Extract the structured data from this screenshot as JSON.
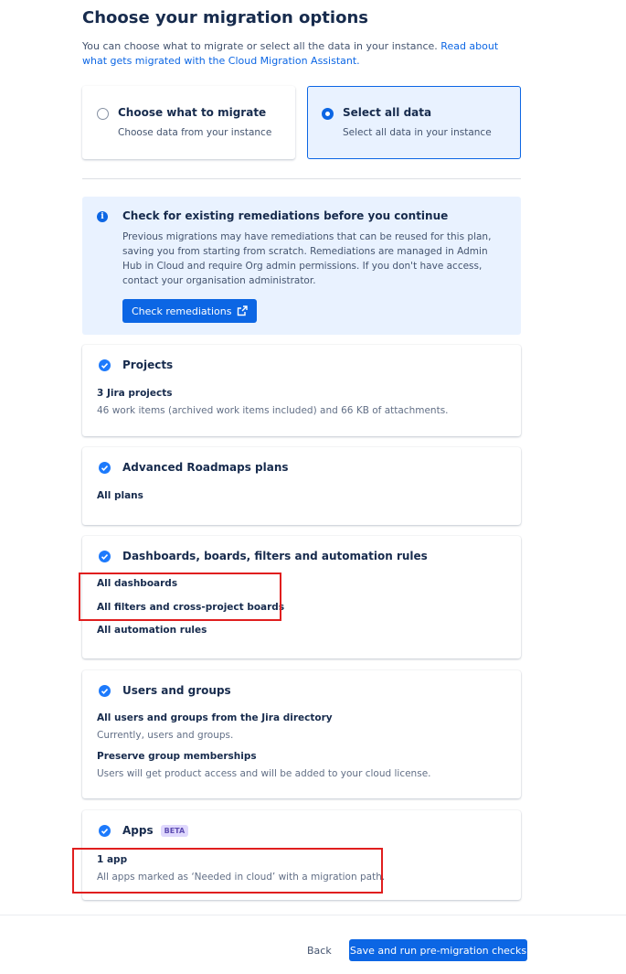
{
  "page": {
    "title": "Choose your migration options",
    "intro_text": "You can choose what to migrate or select all the data in your instance. ",
    "intro_link": "Read about what gets migrated with the Cloud Migration Assistant."
  },
  "options": [
    {
      "title": "Choose what to migrate",
      "desc": "Choose data from your instance",
      "selected": false
    },
    {
      "title": "Select all data",
      "desc": "Select all data in your instance",
      "selected": true
    }
  ],
  "banner": {
    "title": "Check for existing remediations before you continue",
    "body": "Previous migrations may have remediations that can be reused for this plan, saving you from starting from scratch. Remediations are managed in Admin Hub in Cloud and require Org admin permissions. If you don't have access, contact your organisation administrator.",
    "button": "Check remediations"
  },
  "cards": {
    "projects": {
      "title": "Projects",
      "item_title": "3 Jira projects",
      "item_desc": "46 work items (archived work items included) and 66 KB of attachments."
    },
    "roadmaps": {
      "title": "Advanced Roadmaps plans",
      "item_title": "All plans"
    },
    "dashboards": {
      "title": "Dashboards, boards, filters and automation rules",
      "item1": "All dashboards",
      "item2": "All filters and cross-project boards",
      "item3": "All automation rules"
    },
    "users": {
      "title": "Users and groups",
      "item1_title": "All users and groups from the Jira directory",
      "item1_desc": "Currently, users and groups.",
      "item2_title": "Preserve group memberships",
      "item2_desc": "Users will get product access and will be added to your cloud license."
    },
    "apps": {
      "title": "Apps",
      "badge": "BETA",
      "item_title": "1 app",
      "item_desc": "All apps marked as ‘Needed in cloud’ with a migration path."
    }
  },
  "footer": {
    "back": "Back",
    "save": "Save and run pre-migration checks"
  },
  "colors": {
    "primary": "#0c66e4",
    "banner_bg": "#e9f2ff",
    "check": "#1d7afc",
    "highlight": "#e01e1e"
  }
}
